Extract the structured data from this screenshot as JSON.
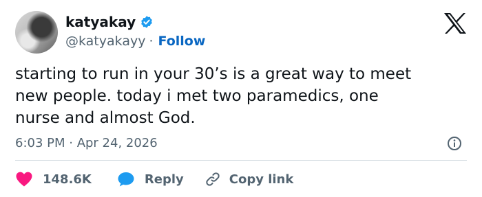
{
  "user": {
    "name": "katyakay",
    "handle": "@katyakayy",
    "separator": "·",
    "follow_label": "Follow"
  },
  "tweet": {
    "text": "starting to run in your 30’s is a great way to meet\nnew people. today i met two paramedics, one\nnurse and almost God.",
    "timestamp": "6:03 PM · Apr 24, 2026"
  },
  "actions": {
    "like_count": "148.6K",
    "reply_label": "Reply",
    "copy_link_label": "Copy link"
  },
  "icons": {
    "verified": "verified-badge-icon",
    "brand": "x-logo-icon",
    "info": "info-icon",
    "like": "heart-icon",
    "reply": "speech-bubble-icon",
    "copy": "link-icon"
  },
  "colors": {
    "follow": "#0a67c2",
    "verified": "#1d9bf0",
    "like": "#f91880",
    "reply": "#1d9bf0",
    "secondary_text": "#536471"
  }
}
